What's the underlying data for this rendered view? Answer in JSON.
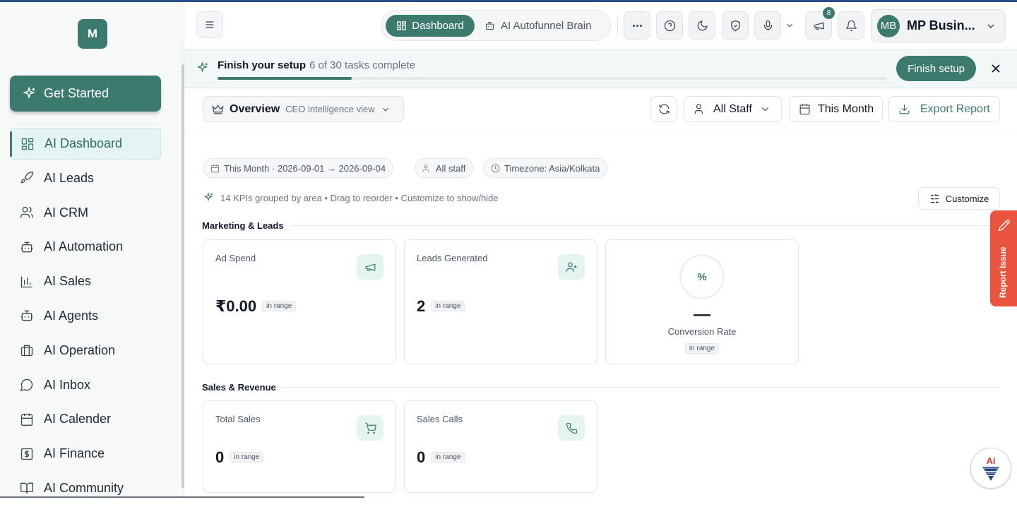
{
  "sidebar": {
    "logo_letter": "M",
    "get_started": "Get Started",
    "items": [
      {
        "label": "AI Dashboard",
        "icon": "grid-icon"
      },
      {
        "label": "AI Leads",
        "icon": "rocket-icon"
      },
      {
        "label": "AI CRM",
        "icon": "users-icon"
      },
      {
        "label": "AI Automation",
        "icon": "bot-icon"
      },
      {
        "label": "AI Sales",
        "icon": "bar-chart-icon"
      },
      {
        "label": "AI Agents",
        "icon": "bot-icon"
      },
      {
        "label": "AI Operation",
        "icon": "briefcase-icon"
      },
      {
        "label": "AI Inbox",
        "icon": "chat-icon"
      },
      {
        "label": "AI Calender",
        "icon": "calendar-icon"
      },
      {
        "label": "AI Finance",
        "icon": "dollar-icon"
      },
      {
        "label": "AI Community",
        "icon": "book-icon"
      }
    ]
  },
  "header": {
    "tabs": {
      "dashboard": "Dashboard",
      "brain": "AI Autofunnel Brain"
    },
    "notification_count": "8",
    "user": {
      "initials": "MB",
      "name": "MP Busin..."
    }
  },
  "setup": {
    "title": "Finish your setup",
    "progress_text": "6 of 30 tasks complete",
    "progress_fraction": 0.2,
    "button": "Finish setup"
  },
  "toolbar": {
    "overview_title": "Overview",
    "overview_sub": "CEO intelligence view",
    "staff": "All Staff",
    "period": "This Month",
    "export": "Export Report"
  },
  "filters": {
    "range": "This Month · 2026-09-01 → 2026-09-04",
    "staff": "All staff",
    "timezone": "Timezone: Asia/Kolkata"
  },
  "kpi_info": "14 KPIs grouped by area • Drag to reorder • Customize to show/hide",
  "customize": "Customize",
  "sections": {
    "marketing": {
      "title": "Marketing & Leads",
      "cards": [
        {
          "label": "Ad Spend",
          "value": "₹0.00",
          "range": "in range"
        },
        {
          "label": "Leads Generated",
          "value": "2",
          "range": "in range"
        }
      ],
      "conversion": {
        "symbol": "%",
        "value": "—",
        "label": "Conversion Rate",
        "range": "in range"
      }
    },
    "sales": {
      "title": "Sales & Revenue",
      "cards": [
        {
          "label": "Total Sales",
          "value": "0",
          "range": "in range"
        },
        {
          "label": "Sales Calls",
          "value": "0",
          "range": "in range"
        }
      ]
    }
  },
  "report_issue": "Report Issue",
  "colors": {
    "accent": "#3b7a6c",
    "report": "#e8543e"
  }
}
